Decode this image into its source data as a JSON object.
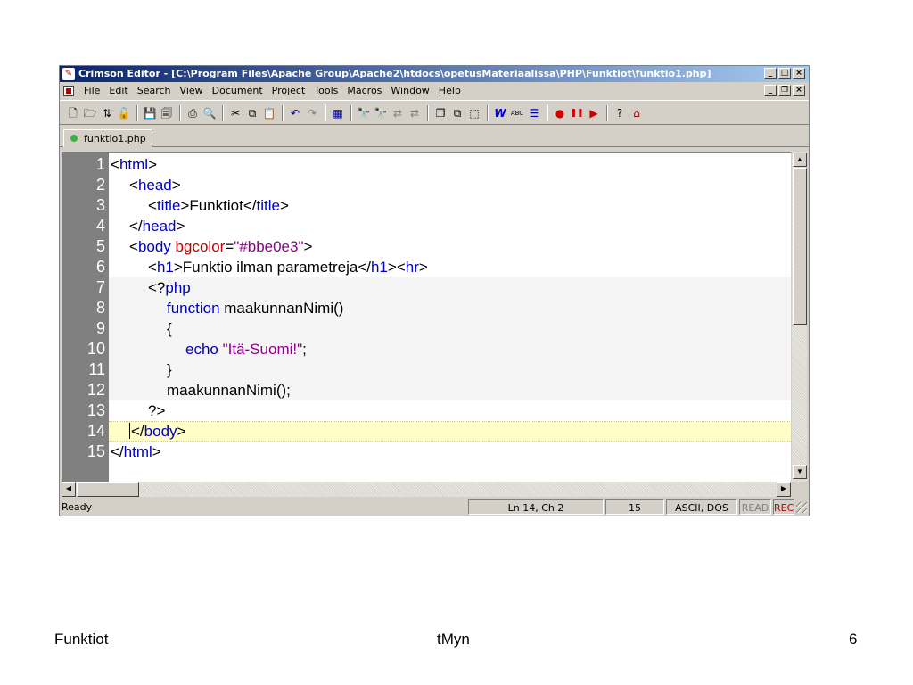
{
  "window": {
    "title": "Crimson Editor - [C:\\Program Files\\Apache Group\\Apache2\\htdocs\\opetusMateriaalissa\\PHP\\Funktiot\\funktio1.php]",
    "caption_buttons": {
      "minimize": "_",
      "restore": "□",
      "close": "×"
    },
    "mdi_buttons": {
      "minimize": "_",
      "restore": "❐",
      "close": "×"
    }
  },
  "menu": {
    "items": [
      "File",
      "Edit",
      "Search",
      "View",
      "Document",
      "Project",
      "Tools",
      "Macros",
      "Window",
      "Help"
    ]
  },
  "toolbar": {
    "icons": [
      "new-file-icon",
      "open-folder-icon",
      "open-remote-icon",
      "open-lock-icon",
      "save-icon",
      "save-all-icon",
      "print-icon",
      "print-preview-icon",
      "cut-icon",
      "copy-icon",
      "paste-icon",
      "undo-icon",
      "redo-icon",
      "column-mode-icon",
      "find-icon",
      "find-next-icon",
      "replace-icon",
      "replace-all-icon",
      "window-cascade-icon",
      "window-tile-icon",
      "file-browser-icon",
      "word-wrap-icon",
      "spell-check-icon",
      "line-numbers-icon",
      "record-macro-icon",
      "pause-macro-icon",
      "play-macro-icon",
      "help-icon",
      "home-icon"
    ],
    "glyphs": {
      "word_wrap": "W",
      "spell_check": "ABC",
      "help": "?"
    }
  },
  "tab": {
    "label": "funktio1.php"
  },
  "code": {
    "line_numbers": [
      "1",
      "2",
      "3",
      "4",
      "5",
      "6",
      "7",
      "8",
      "9",
      "10",
      "11",
      "12",
      "13",
      "14",
      "15"
    ],
    "l1": {
      "a": "<",
      "b": "html",
      "c": ">"
    },
    "l2": {
      "a": "<",
      "b": "head",
      "c": ">"
    },
    "l3": {
      "a": "<",
      "b": "title",
      "c": ">",
      "d": "Funktiot",
      "e": "</",
      "f": "title",
      "g": ">"
    },
    "l4": {
      "a": "</",
      "b": "head",
      "c": ">"
    },
    "l5": {
      "a": "<",
      "b": "body",
      "c": "bgcolor",
      "d": "=",
      "e": "\"#bbe0e3\"",
      "f": ">"
    },
    "l6": {
      "a": "<",
      "b": "h1",
      "c": ">",
      "d": "Funktio ilman parametreja",
      "e": "</",
      "f": "h1",
      "g": "><",
      "h": "hr",
      "i": ">"
    },
    "l7": {
      "a": "<?",
      "b": "php"
    },
    "l8": {
      "a": "function",
      "b": " maakunnanNimi()"
    },
    "l9": {
      "a": "{"
    },
    "l10": {
      "a": "echo",
      "b": "\"Itä-Suomi!\"",
      "c": ";"
    },
    "l11": {
      "a": "}"
    },
    "l12": {
      "a": "maakunnanNimi();"
    },
    "l13": {
      "a": "?>"
    },
    "l14": {
      "a": "</",
      "b": "body",
      "c": ">"
    },
    "l15": {
      "a": "</",
      "b": "html",
      "c": ">"
    }
  },
  "status": {
    "message": "Ready",
    "position": "Ln 14, Ch 2",
    "line_count": "15",
    "encoding": "ASCII, DOS",
    "read": "READ",
    "rec": "REC"
  },
  "footer": {
    "left": "Funktiot",
    "center": "tMyn",
    "right": "6"
  }
}
